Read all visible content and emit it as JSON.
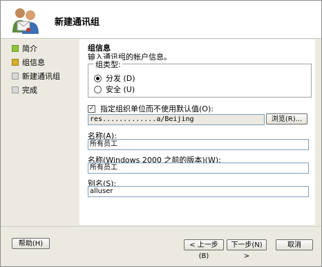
{
  "header": {
    "title": "新建通讯组"
  },
  "nav": {
    "items": [
      {
        "label": "简介",
        "state": "done"
      },
      {
        "label": "组信息",
        "state": "current"
      },
      {
        "label": "新建通讯组",
        "state": "pending"
      },
      {
        "label": "完成",
        "state": "pending"
      }
    ]
  },
  "content": {
    "title": "组信息",
    "subtitle": "输入通讯组的帐户信息。",
    "group_type": {
      "label": "组类型:",
      "options": [
        {
          "label": "分发 (D)",
          "checked": true
        },
        {
          "label": "安全 (U)",
          "checked": false
        }
      ]
    },
    "ou": {
      "checkbox_label": "指定组织单位而不使用默认值(O):",
      "checked": true,
      "value": "res.............a/Beijing",
      "browse_label": "浏览(R)..."
    },
    "name": {
      "label": "名称(A):",
      "value": "所有员工"
    },
    "pre2000": {
      "label": "名称(Windows 2000 之前的版本)(W):",
      "value": "所有员工"
    },
    "alias": {
      "label": "别名(S):",
      "value": "alluser"
    }
  },
  "footer": {
    "help_label": "帮助(H)",
    "back_label": "< 上一步(B)",
    "next_label": "下一步(N) >",
    "cancel_label": "取消"
  }
}
